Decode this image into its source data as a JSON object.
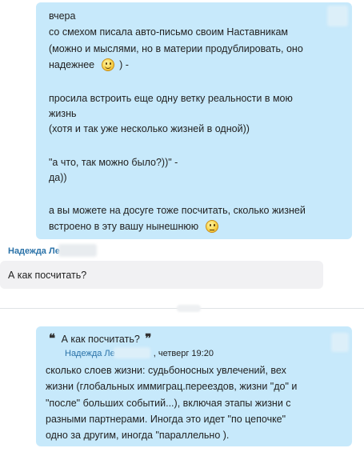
{
  "msg1": {
    "lines": [
      "вчера",
      "со смехом писала авто-письмо своим Наставникам",
      "(можно и мыслями, но в материи продублировать, оно",
      "надежнее",
      ") -",
      "",
      "просила встроить еще одну ветку реальности в мою",
      "жизнь",
      "(хотя и так уже несколько жизней в одной))",
      "",
      "\"а что, так можно было?))\" -",
      "да))",
      "",
      "а вы можете на досуге тоже посчитать, сколько жизней",
      "встроено в эту вашу нынешнюю"
    ],
    "emoji_smile": "smile-emoji-icon",
    "emoji_thinking": "thinking-emoji-icon"
  },
  "sender2": {
    "name": "Надежда Ле"
  },
  "msg2": {
    "text": "А как посчитать?"
  },
  "msg3": {
    "quote_open": "❝",
    "quote_text": "А как посчитать?",
    "quote_close": "❞",
    "quote_author": "Надежда Ле",
    "quote_time": ", четверг 19:20",
    "lines": [
      "сколько слоев жизни: судьбоносных увлечений, вех",
      "жизни (глобальных иммиграц.переездов, жизни \"до\" и",
      "\"после\" больших событий...), включая этапы жизни с",
      "разными партнерами. Иногда это идет \"по цепочке\"",
      "одно за другим, иногда \"параллельно )."
    ]
  }
}
